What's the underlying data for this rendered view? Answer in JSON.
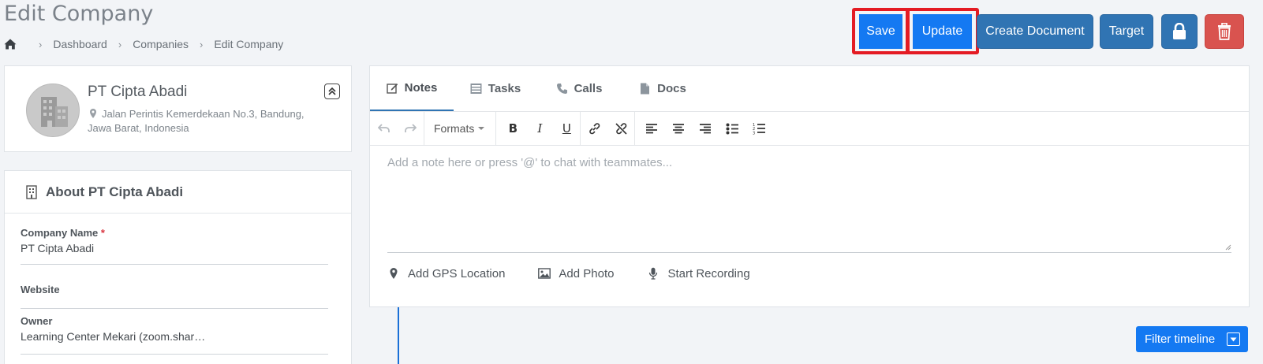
{
  "page": {
    "title": "Edit Company",
    "breadcrumb": [
      "Dashboard",
      "Companies",
      "Edit Company"
    ]
  },
  "toolbar_buttons": {
    "save": "Save",
    "update": "Update",
    "create_document": "Create Document",
    "target": "Target"
  },
  "company": {
    "name": "PT Cipta Abadi",
    "address": "Jalan Perintis Kemerdekaan No.3, Bandung, Jawa Barat, Indonesia"
  },
  "about": {
    "title": "About PT Cipta Abadi",
    "fields": {
      "company_name_label": "Company Name",
      "company_name_value": "PT Cipta Abadi",
      "website_label": "Website",
      "website_value": "",
      "owner_label": "Owner",
      "owner_value": "Learning Center Mekari (zoom.shar…"
    }
  },
  "tabs": [
    "Notes",
    "Tasks",
    "Calls",
    "Docs"
  ],
  "editor": {
    "formats_label": "Formats",
    "placeholder": "Add a note here or press '@' to chat with teammates...",
    "actions": [
      "Add GPS Location",
      "Add Photo",
      "Start Recording"
    ]
  },
  "timeline": {
    "filter_label": "Filter timeline"
  },
  "colors": {
    "primary": "#3074b3",
    "highlight_blue": "#1479f2",
    "danger": "#d9534f",
    "outline_red": "#e41b23"
  }
}
